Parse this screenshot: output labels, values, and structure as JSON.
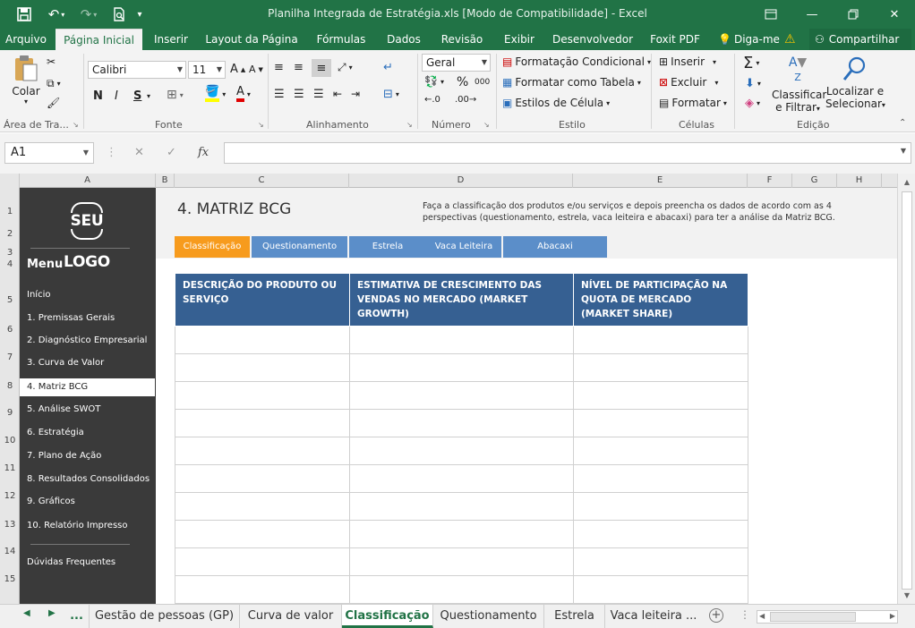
{
  "window": {
    "title": "Planilha Integrada de Estratégia.xls  [Modo de Compatibilidade] - Excel"
  },
  "ribbon_tabs": [
    "Arquivo",
    "Página Inicial",
    "Inserir",
    "Layout da Página",
    "Fórmulas",
    "Dados",
    "Revisão",
    "Exibir",
    "Desenvolvedor",
    "Foxit PDF"
  ],
  "active_tab": "Página Inicial",
  "tell_me": "Diga-me",
  "share": "Compartilhar",
  "ribbon": {
    "clipboard": {
      "paste": "Colar",
      "label": "Área de Tra..."
    },
    "font": {
      "name": "Calibri",
      "size": "11",
      "bold": "N",
      "italic": "I",
      "underline": "S",
      "label": "Fonte"
    },
    "alignment": {
      "label": "Alinhamento"
    },
    "number": {
      "format": "Geral",
      "percent": "%",
      "thousands": "000",
      "label": "Número"
    },
    "style": {
      "conditional": "Formatação Condicional",
      "table": "Formatar como Tabela",
      "cell": "Estilos de Célula",
      "label": "Estilo"
    },
    "cells": {
      "insert": "Inserir",
      "delete": "Excluir",
      "format": "Formatar",
      "label": "Células"
    },
    "editing": {
      "sort1": "Classificar",
      "sort2": "e Filtrar",
      "find1": "Localizar e",
      "find2": "Selecionar",
      "label": "Edição"
    }
  },
  "formula_bar": {
    "cell_ref": "A1",
    "value": "",
    "fx": "fx"
  },
  "columns": [
    "A",
    "B",
    "C",
    "D",
    "E",
    "F",
    "G",
    "H"
  ],
  "rows": [
    "1",
    "2",
    "3",
    "4",
    "5",
    "6",
    "7",
    "8",
    "9",
    "10",
    "11",
    "12",
    "13",
    "14",
    "15"
  ],
  "sidebar": {
    "logo": "SEU LOGO",
    "menu_title": "Menu",
    "items": [
      "Início",
      "1. Premissas Gerais",
      "2. Diagnóstico Empresarial",
      "3. Curva de Valor",
      "4. Matriz BCG",
      "5. Análise SWOT",
      "6. Estratégia",
      "7. Plano de Ação",
      "8. Resultados Consolidados",
      "9. Gráficos",
      "10. Relatório Impresso"
    ],
    "active_item": "4. Matriz BCG",
    "faq": "Dúvidas Frequentes"
  },
  "sheet": {
    "title": "4. MATRIZ BCG",
    "description": "Faça a classificação dos produtos e/ou serviços e depois preencha os dados de acordo com as 4 perspectivas (questionamento, estrela, vaca leiteira e abacaxi) para ter a análise da Matriz BCG.",
    "subtabs": [
      "Classificação",
      "Questionamento",
      "Estrela",
      "Vaca Leiteira",
      "Abacaxi"
    ],
    "active_subtab": "Classificação",
    "table_headers": [
      "DESCRIÇÃO DO PRODUTO OU SERVIÇO",
      "ESTIMATIVA DE CRESCIMENTO DAS VENDAS NO MERCADO (MARKET GROWTH)",
      "NÍVEL DE PARTICIPAÇÃO NA QUOTA DE MERCADO (MARKET SHARE)"
    ],
    "table_rows": 10
  },
  "sheet_tabs": [
    "...",
    "Gestão de pessoas (GP)",
    "Curva de valor",
    "Classificação",
    "Questionamento",
    "Estrela",
    "Vaca leiteira ..."
  ],
  "active_sheet_tab": "Classificação",
  "colors": {
    "excel_green": "#217346",
    "header_blue": "#366092",
    "tab_blue": "#5b8ec9",
    "tab_orange": "#f79b1d",
    "sidebar": "#3a3a3a"
  }
}
